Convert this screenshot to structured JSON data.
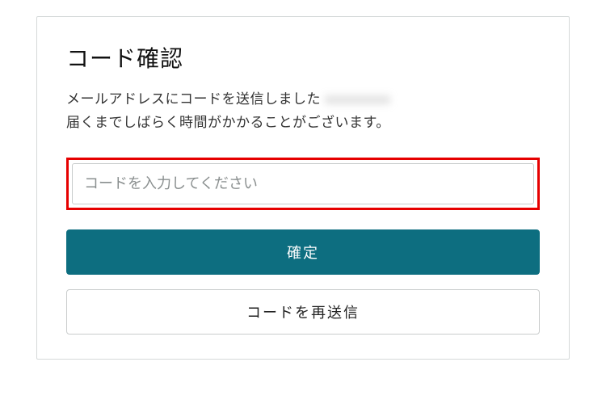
{
  "card": {
    "title": "コード確認",
    "description_line1_prefix": "メールアドレスにコードを送信しました ",
    "description_line1_masked": "xxxxxxxxx",
    "description_line2": "届くまでしばらく時間がかかることがございます。",
    "code_input_placeholder": "コードを入力してください",
    "confirm_label": "確定",
    "resend_label": "コードを再送信"
  }
}
